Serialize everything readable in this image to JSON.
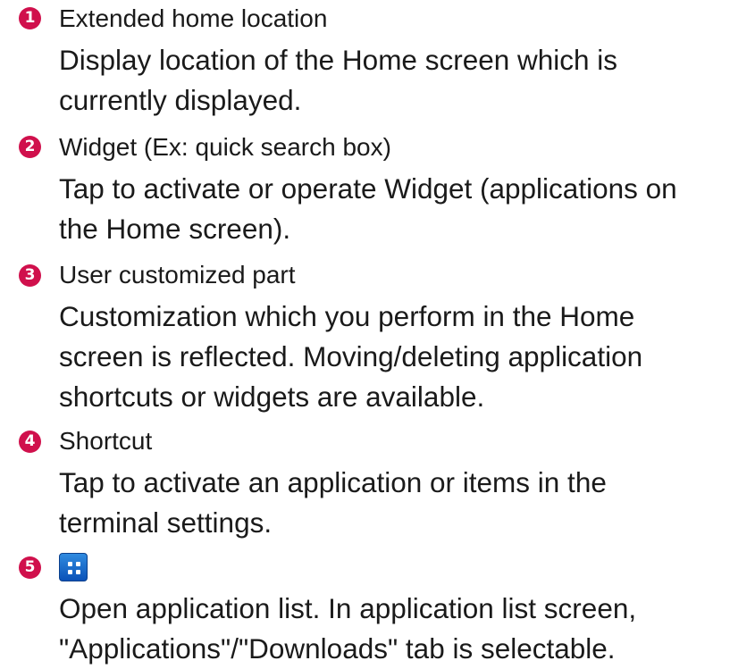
{
  "items": [
    {
      "number": "1",
      "heading": "Extended home location",
      "lines": [
        "Display location of the Home screen which is",
        "currently displayed."
      ]
    },
    {
      "number": "2",
      "heading": "Widget (Ex: quick search box)",
      "lines": [
        "Tap to activate or operate Widget (applications on",
        "the Home screen)."
      ]
    },
    {
      "number": "3",
      "heading": "User customized part",
      "lines": [
        "Customization which you perform in the Home",
        "screen is reflected. Moving/deleting application",
        "shortcuts or widgets are available."
      ]
    },
    {
      "number": "4",
      "heading": "Shortcut",
      "lines": [
        "Tap to activate an application or items in the",
        "terminal settings."
      ]
    },
    {
      "number": "5",
      "heading_icon": "app-list-icon",
      "lines": [
        "Open application list. In application list screen,",
        "\"Applications\"/\"Downloads\" tab is selectable."
      ]
    }
  ],
  "colors": {
    "badge": "#d0104c",
    "text": "#1a1a1a",
    "icon": "#1565c0"
  }
}
